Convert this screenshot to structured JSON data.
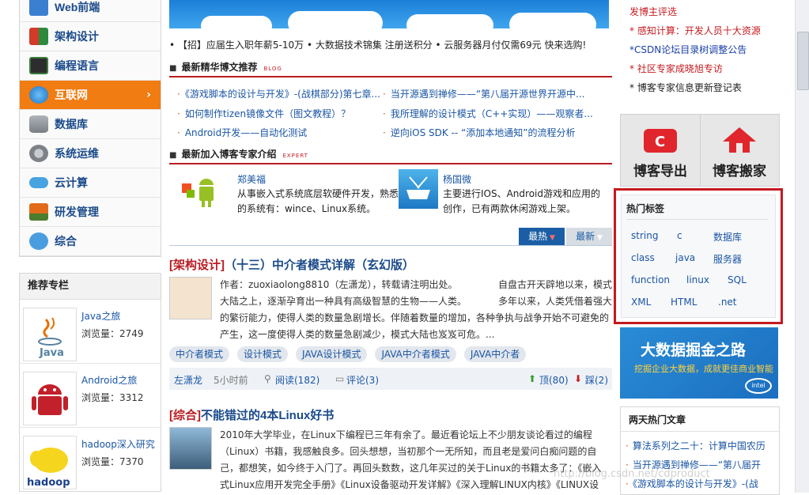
{
  "left_nav": {
    "items": [
      {
        "label": "Web前端",
        "icon": "web-icon",
        "color": "#3b7fd0"
      },
      {
        "label": "架构设计",
        "icon": "blocks-icon",
        "color": "#d23b2a"
      },
      {
        "label": "编程语言",
        "icon": "code-screen-icon",
        "color": "#3c7a3c"
      },
      {
        "label": "互联网",
        "icon": "globe-icon",
        "color": "#2f7fd6",
        "active": true,
        "arrow": "›"
      },
      {
        "label": "数据库",
        "icon": "database-icon",
        "color": "#8a8f96"
      },
      {
        "label": "系统运维",
        "icon": "gears-icon",
        "color": "#7d8288"
      },
      {
        "label": "云计算",
        "icon": "cloud-icon",
        "color": "#48a3e0"
      },
      {
        "label": "研发管理",
        "icon": "tdd-icon",
        "color": "#e26b1b"
      },
      {
        "label": "综合",
        "icon": "chat-icon",
        "color": "#4a9ee0"
      }
    ]
  },
  "recommend": {
    "heading": "推荐专栏",
    "items": [
      {
        "title": "Java之旅",
        "views": "浏览量：2749",
        "icon": "java-logo"
      },
      {
        "title": "Android之旅",
        "views": "浏览量：3312",
        "icon": "android-logo"
      },
      {
        "title": "hadoop深入研究",
        "views": "浏览量：7370",
        "icon": "hadoop-logo"
      }
    ]
  },
  "ad_line": "• 【招】应届生入职年薪5-10万 • 大数据技术锦集 注册送积分 • 云服务器月付仅需69元 快来选购!",
  "featured": {
    "title": "最新精华博文推荐",
    "tag": "BLOG",
    "links": [
      "《游戏脚本的设计与开发》-(战棋部分)第七章...",
      "当开源遇到禅修——“第八届开源世界开源中...",
      "如何制作tizen镜像文件（图文教程）？",
      "我所理解的设计模式（C++实现）——观察者...",
      "Android开发——自动化测试",
      "逆向iOS SDK -- “添加本地通知”的流程分析"
    ]
  },
  "experts": {
    "title": "最新加入博客专家介绍",
    "tag": "EXPERT",
    "items": [
      {
        "name": "郑美福",
        "desc": "从事嵌入式系统底层软硬件开发，熟悉的系统有：wince、Linux系统。"
      },
      {
        "name": "杨国微",
        "desc": "主要进行IOS、Android游戏和应用的创作，已有两款休闲游戏上架。"
      }
    ]
  },
  "tabs": {
    "hot": "最热",
    "new": "最新"
  },
  "post1": {
    "category": "[架构设计]",
    "title": "（十三）中介者模式详解（玄幻版）",
    "line1a": "作者：zuoxiaolong8810（左潇龙），转载请注明出处。",
    "line1b": "自盘古开天辟地以来，模式",
    "line2a": "大陆之上，逐渐孕育出一种具有高级智慧的生物——人类。",
    "line2b": "多年以来，人类凭借着强大",
    "line3": "的繁衍能力，使得人类的数量急剧增长。伴随着数量的增加，各种争执与战争开始不可避免的",
    "line4": "产生，这一度使得人类的数量急剧减少，模式大陆也岌岌可危。...",
    "tags": [
      "中介者模式",
      "设计模式",
      "JAVA设计模式",
      "JAVA中介者模式",
      "JAVA中介者"
    ],
    "author": "左潇龙",
    "time": "5小时前",
    "reads": "阅读(182)",
    "comments": "评论(3)",
    "up": "顶(80)",
    "down": "踩(2)"
  },
  "post2": {
    "category": "[综合]",
    "title": "不能错过的4本Linux好书",
    "line1": "2010年大学毕业，在Linux下编程已三年有余了。最近看论坛上不少朋友谈论看过的编程",
    "line2": "（Linux）书籍，我感触良多。回头想想，当初那个一无所知，而且老是爱问白痴问题的自",
    "line3": "己，都想笑，如今终于入门了。再回头数数，这几年买过的关于Linux的书籍太多了：《嵌入",
    "line4": "式Linux应用开发完全手册》《Linux设备驱动开发详解》《深入理解LINUX内核》《LINUX设"
  },
  "right_links": [
    {
      "text": "发博主评选",
      "color": "#c41a1f"
    },
    {
      "text": "* 感知计算：开发人员十大资源",
      "color": "#c41a1f"
    },
    {
      "text": "*CSDN论坛目录树调整公告",
      "color": "#1a3fa8"
    },
    {
      "text": "* 社区专家成晓旭专访",
      "color": "#c41a1f"
    },
    {
      "text": "* 博客专家信息更新登记表",
      "color": "#222222"
    }
  ],
  "buttons": {
    "export": "博客导出",
    "move": "博客搬家"
  },
  "hot_tags": {
    "heading": "热门标签",
    "tags": [
      "string",
      "c",
      "数据库",
      "class",
      "java",
      "服务器",
      "function",
      "linux",
      "SQL",
      "XML",
      "HTML",
      ".net"
    ]
  },
  "ad_bigdata": {
    "title": "大数据掘金之路",
    "subtitle": "挖掘企业大数据，成就更佳商业智能",
    "brand": "intel"
  },
  "two_day": {
    "heading": "两天热门文章",
    "items": [
      "算法系列之二十：计算中国农历",
      "当开源遇到禅修——“第八届开",
      "《游戏脚本的设计与开发》-(战"
    ]
  },
  "watermark": "http://blog.csdn.net/cdproduct",
  "colors": {
    "accent_red": "#c41a1f",
    "nav_active": "#f07c12",
    "link_blue": "#1a55a3"
  }
}
